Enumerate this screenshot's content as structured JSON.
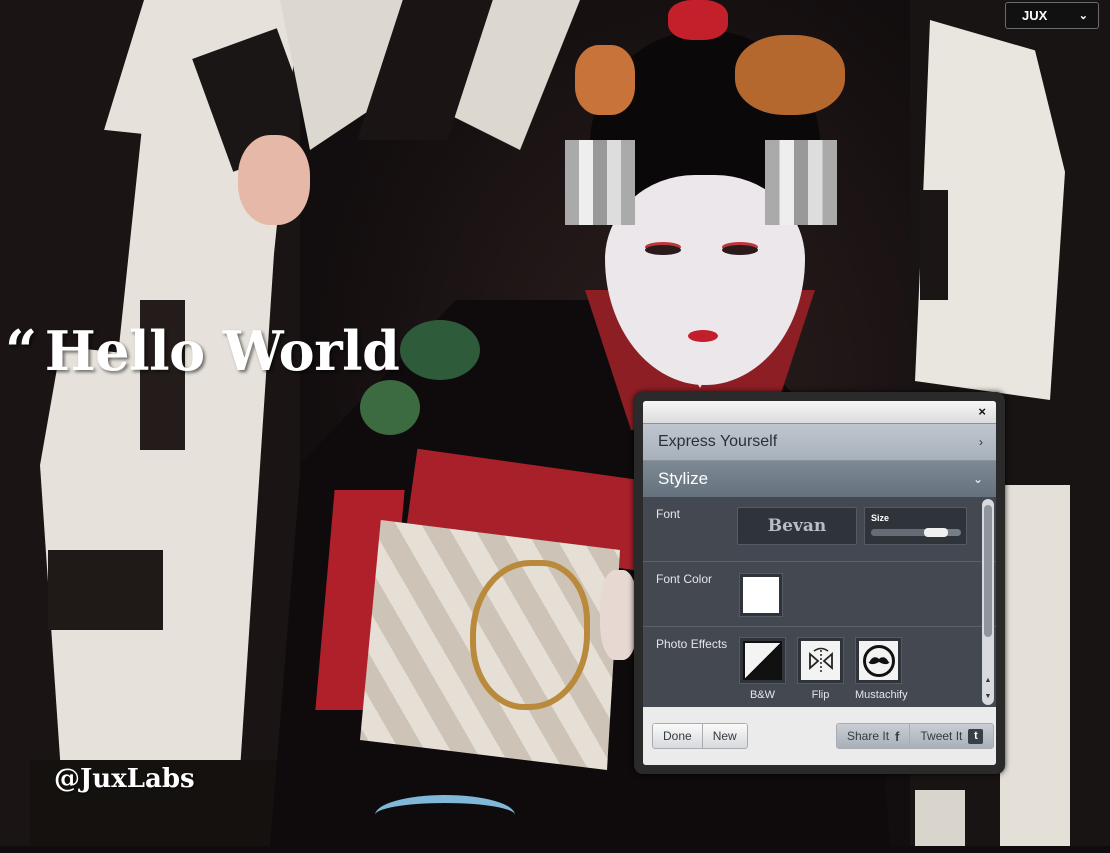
{
  "header": {
    "app_button_label": "JUX",
    "chevron": "chevron-down-icon"
  },
  "canvas": {
    "quote_mark": "“",
    "title": "Hello World",
    "handle": "@JuxLabs"
  },
  "panel": {
    "close_label": "×",
    "sections": [
      {
        "label": "Express Yourself",
        "expanded": false
      },
      {
        "label": "Stylize",
        "expanded": true
      }
    ],
    "font": {
      "label": "Font",
      "value": "Bevan",
      "size_label": "Size",
      "size_level": 0.8
    },
    "font_color": {
      "label": "Font Color",
      "value": "#ffffff"
    },
    "photo_effects": {
      "label": "Photo Effects",
      "items": [
        {
          "label": "B&W",
          "icon": "bw-icon"
        },
        {
          "label": "Flip",
          "icon": "flip-icon"
        },
        {
          "label": "Mustachify",
          "icon": "mustache-icon"
        }
      ]
    },
    "footer": {
      "done_label": "Done",
      "new_label": "New",
      "share_label": "Share It",
      "share_icon": "f",
      "tweet_label": "Tweet It",
      "tweet_icon": "t"
    }
  },
  "colors": {
    "panel_active_header": "#6f7b87",
    "panel_body": "#434851"
  }
}
